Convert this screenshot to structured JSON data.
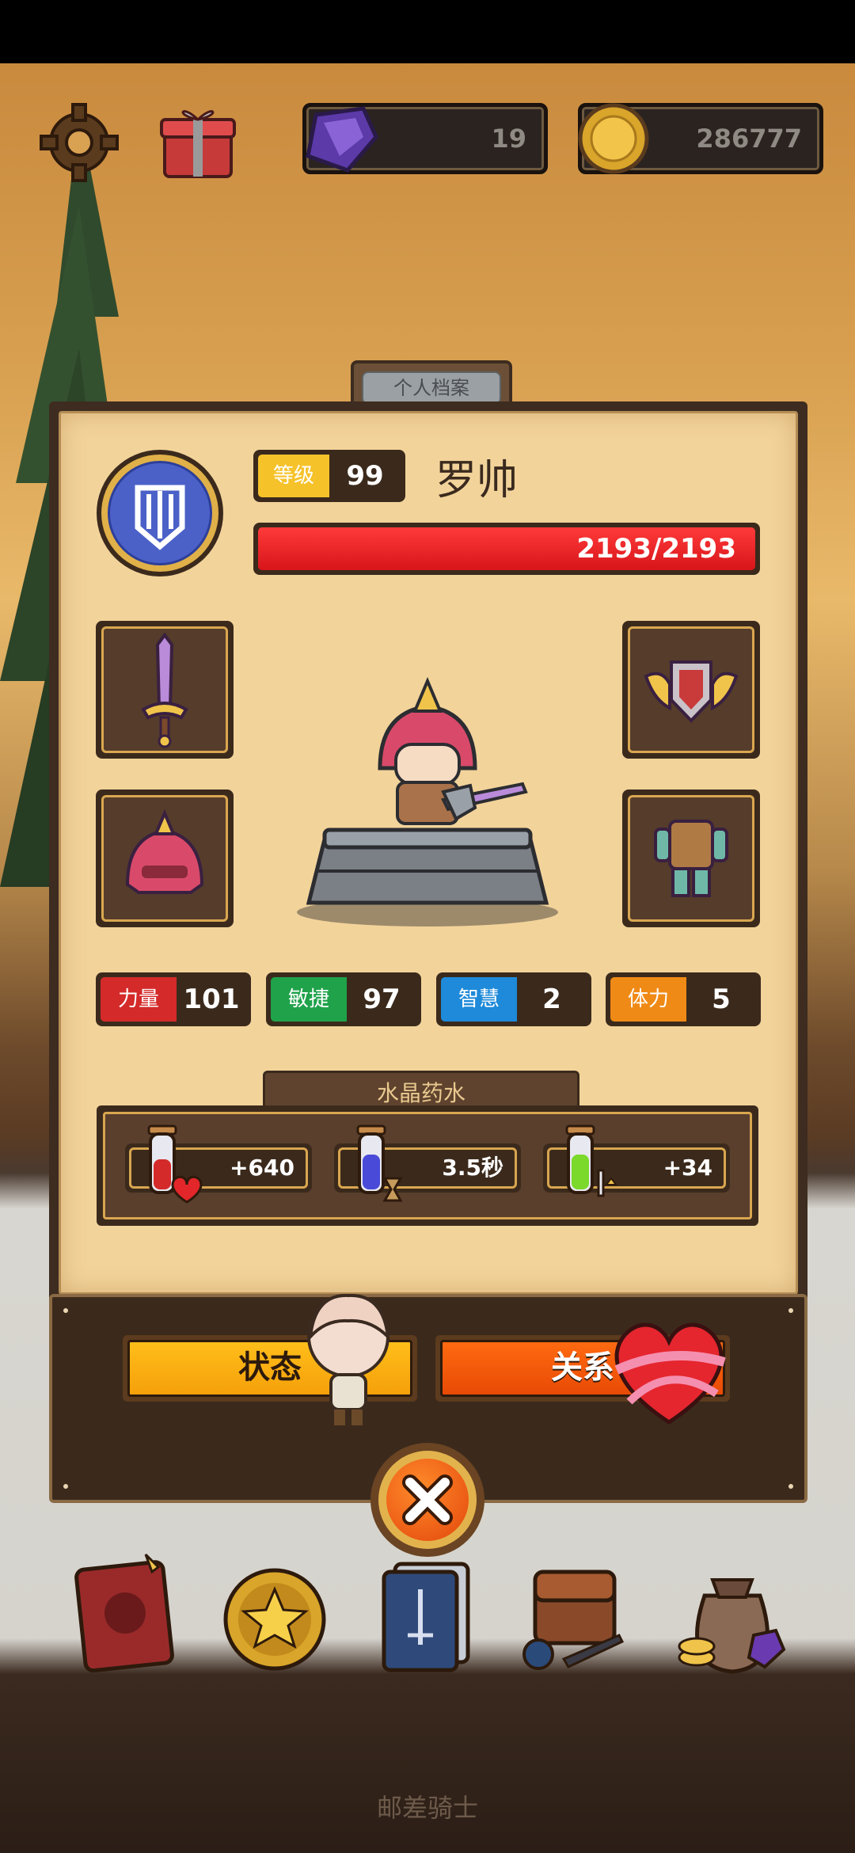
{
  "hud": {
    "gems": "19",
    "gold": "286777"
  },
  "profile": {
    "tab_title": "个人档案",
    "level_label": "等级",
    "level": "99",
    "name": "罗帅",
    "hp_text": "2193/2193",
    "hp_fraction": 1.0
  },
  "stats": [
    {
      "label": "力量",
      "value": "101",
      "color": "#d42a2a"
    },
    {
      "label": "敏捷",
      "value": "97",
      "color": "#1fa24a"
    },
    {
      "label": "智慧",
      "value": "2",
      "color": "#1e8ad9"
    },
    {
      "label": "体力",
      "value": "5",
      "color": "#f08a16"
    }
  ],
  "potions": {
    "title": "水晶药水",
    "items": [
      {
        "value": "+640",
        "icon": "health-potion-icon"
      },
      {
        "value": "3.5秒",
        "icon": "time-potion-icon"
      },
      {
        "value": "+34",
        "icon": "attack-potion-icon"
      }
    ]
  },
  "buttons": {
    "status": "状态",
    "relations": "关系"
  },
  "footer": {
    "title": "邮差骑士"
  }
}
